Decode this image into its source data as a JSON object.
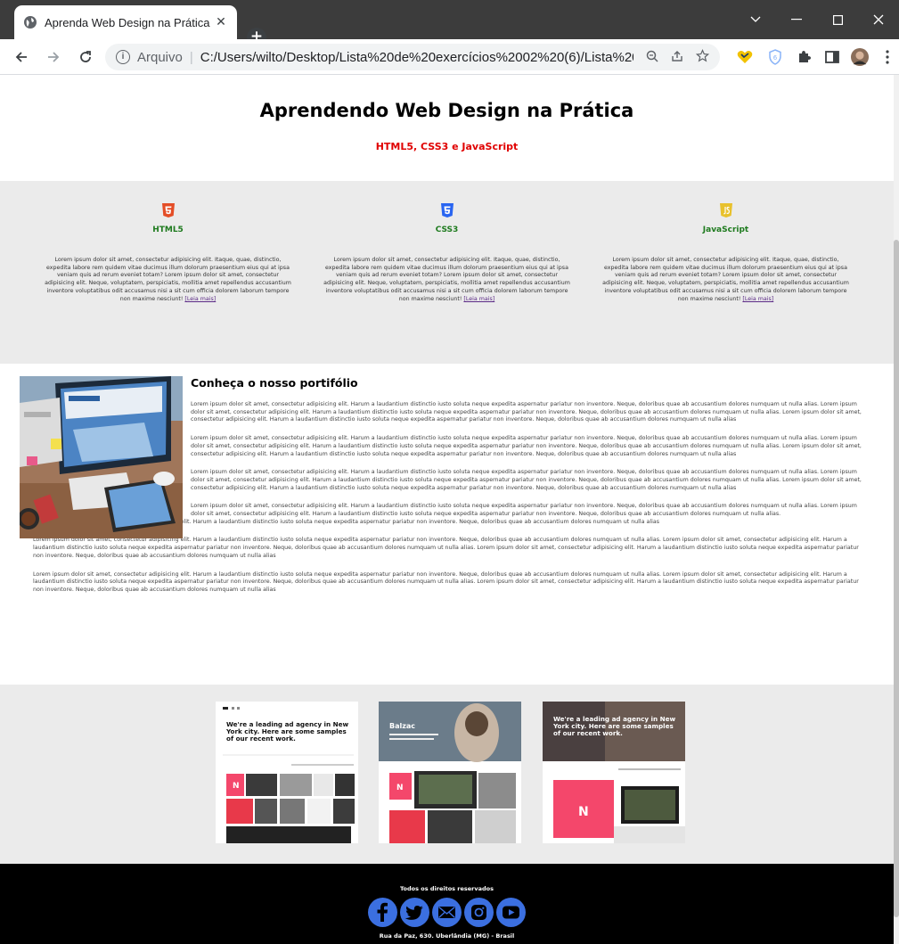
{
  "browser": {
    "tab_title": "Aprenda Web Design na Prática |",
    "tab_close": "✕",
    "new_tab": "+",
    "security_label": "Arquivo",
    "url": "C:/Users/wilto/Desktop/Lista%20de%20exercícios%2002%20(6)/Lista%20d...",
    "window_controls": [
      "chevron-down-icon",
      "minimize-icon",
      "maximize-icon",
      "close-icon"
    ]
  },
  "header": {
    "title": "Aprendendo Web Design na Prática",
    "subtitle": "HTML5, CSS3 e JavaScript"
  },
  "features": [
    {
      "icon": "html5-icon",
      "color": "#e44d26",
      "title": "HTML5",
      "text": "Lorem ipsum dolor sit amet, consectetur adipisicing elit. Itaque, quae, distinctio, expedita labore rem quidem vitae ducimus illum dolorum praesentium eius qui at ipsa veniam quis ad rerum eveniet totam? Lorem ipsum dolor sit amet, consectetur adipisicing elit. Neque, voluptatem, perspiciatis, mollitia amet repellendus accusantium inventore voluptatibus odit accusamus nisi a sit cum officia dolorem laborum tempore non maxime nesciunt!",
      "link": "[Leia mais]"
    },
    {
      "icon": "css3-icon",
      "color": "#2965f1",
      "title": "CSS3",
      "text": "Lorem ipsum dolor sit amet, consectetur adipisicing elit. Itaque, quae, distinctio, expedita labore rem quidem vitae ducimus illum dolorum praesentium eius qui at ipsa veniam quis ad rerum eveniet totam? Lorem ipsum dolor sit amet, consectetur adipisicing elit. Neque, voluptatem, perspiciatis, mollitia amet repellendus accusantium inventore voluptatibus odit accusamus nisi a sit cum officia dolorem laborum tempore non maxime nesciunt!",
      "link": "[Leia mais]"
    },
    {
      "icon": "javascript-icon",
      "color": "#e8c12c",
      "title": "JavaScript",
      "text": "Lorem ipsum dolor sit amet, consectetur adipisicing elit. Itaque, quae, distinctio, expedita labore rem quidem vitae ducimus illum dolorum praesentium eius qui at ipsa veniam quis ad rerum eveniet totam? Lorem ipsum dolor sit amet, consectetur adipisicing elit. Neque, voluptatem, perspiciatis, mollitia amet repellendus accusantium inventore voluptatibus odit accusamus nisi a sit cum officia dolorem laborum tempore non maxime nesciunt!",
      "link": "[Leia mais]"
    }
  ],
  "portfolio": {
    "title": "Conheça o nosso portifólio",
    "para_wrapped": "Lorem ipsum dolor sit amet, consectetur adipisicing elit. Harum a laudantium distinctio iusto soluta neque expedita aspernatur pariatur non inventore. Neque, doloribus quae ab accusantium dolores numquam ut nulla alias. Lorem ipsum dolor sit amet, consectetur adipisicing elit. Harum a laudantium distinctio iusto soluta neque expedita aspernatur pariatur non inventore. Neque, doloribus quae ab accusantium dolores numquam ut nulla alias. Lorem ipsum dolor sit amet, consectetur adipisicing elit. Harum a laudantium distinctio iusto soluta neque expedita aspernatur pariatur non inventore. Neque, doloribus quae ab accusantium dolores numquam ut nulla alias",
    "para4_top": "Lorem ipsum dolor sit amet, consectetur adipisicing elit. Harum a laudantium distinctio iusto soluta neque expedita aspernatur pariatur non inventore. Neque, doloribus quae ab accusantium dolores numquam ut nulla alias. Lorem ipsum dolor sit amet, consectetur adipisicing elit. Harum a laudantium distinctio iusto soluta neque expedita aspernatur pariatur non inventore. Neque, doloribus quae ab accusantium dolores numquam ut nulla alias.",
    "para4_bottom": "Lorem ipsum dolor sit amet, consectetur adipisicing elit. Harum a laudantium distinctio iusto soluta neque expedita aspernatur pariatur non inventore. Neque, doloribus quae ab accusantium dolores numquam ut nulla alias",
    "para_full": "Lorem ipsum dolor sit amet, consectetur adipisicing elit. Harum a laudantium distinctio iusto soluta neque expedita aspernatur pariatur non inventore. Neque, doloribus quae ab accusantium dolores numquam ut nulla alias. Lorem ipsum dolor sit amet, consectetur adipisicing elit. Harum a laudantium distinctio iusto soluta neque expedita aspernatur pariatur non inventore. Neque, doloribus quae ab accusantium dolores numquam ut nulla alias. Lorem ipsum dolor sit amet, consectetur adipisicing elit. Harum a laudantium distinctio iusto soluta neque expedita aspernatur pariatur non inventore. Neque, doloribus quae ab accusantium dolores numquam ut nulla alias"
  },
  "gallery": [
    {
      "headline": "We're a leading ad agency in New York city. Here are some samples of our recent work.",
      "tile": "N"
    },
    {
      "headline": "Balzac",
      "tile": "N"
    },
    {
      "headline": "We're a leading ad agency in New York city. Here are some samples of our recent work.",
      "tile": "N"
    }
  ],
  "footer": {
    "rights": "Todos os direitos reservados",
    "socials": [
      "facebook-icon",
      "twitter-icon",
      "email-icon",
      "instagram-icon",
      "youtube-icon"
    ],
    "address": "Rua da Paz, 630. Uberlândia (MG) - Brasil"
  }
}
